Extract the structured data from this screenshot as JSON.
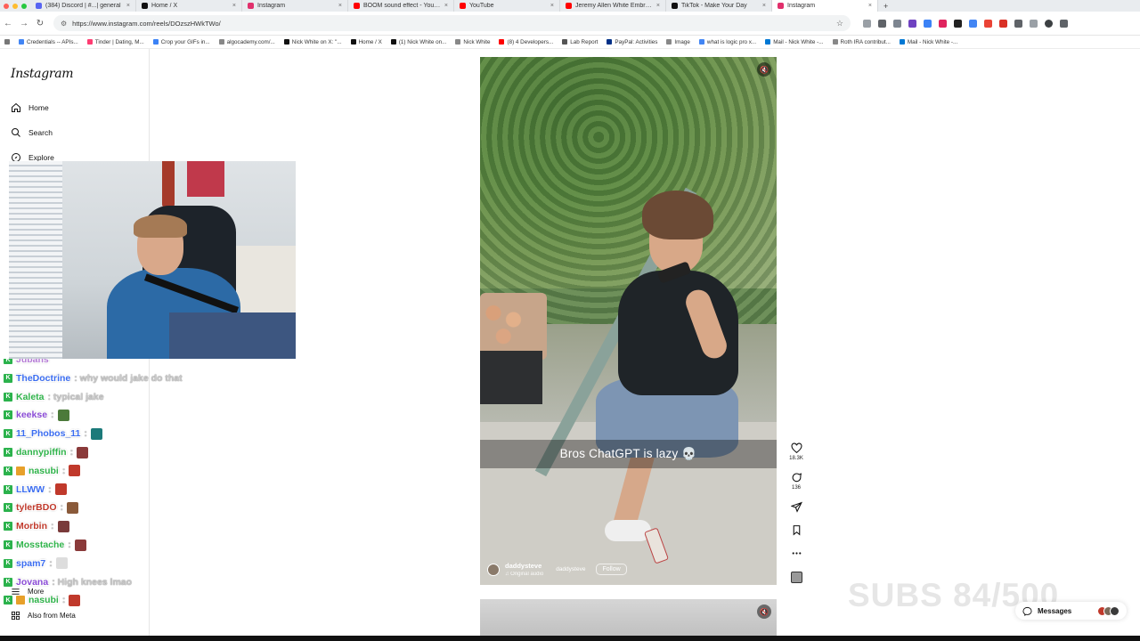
{
  "browser": {
    "tabs": [
      {
        "label": "(384) Discord | #...| general",
        "color": "#5865f2",
        "active": false
      },
      {
        "label": "Home / X",
        "color": "#111111",
        "active": false
      },
      {
        "label": "Instagram",
        "color": "#e1306c",
        "active": false
      },
      {
        "label": "BOOM sound effect - YouTube",
        "color": "#ff0000",
        "active": false
      },
      {
        "label": "YouTube",
        "color": "#ff0000",
        "active": false
      },
      {
        "label": "Jeremy Allen White Embrace",
        "color": "#ff0000",
        "active": false
      },
      {
        "label": "TikTok - Make Your Day",
        "color": "#111111",
        "active": false
      },
      {
        "label": "Instagram",
        "color": "#e1306c",
        "active": true
      }
    ],
    "url": "https://www.instagram.com/reels/DOzszHWkTWo/",
    "bookmarks": [
      {
        "label": "Credentials -- APIs...",
        "color": "#4285f4"
      },
      {
        "label": "Tinder | Dating, M...",
        "color": "#fe3c72"
      },
      {
        "label": "Crop your GIFs in...",
        "color": "#3b82f6"
      },
      {
        "label": "algocademy.com/...",
        "color": "#888888"
      },
      {
        "label": "Nick White on X: \"...",
        "color": "#111111"
      },
      {
        "label": "Home / X",
        "color": "#111111"
      },
      {
        "label": "(1) Nick White on...",
        "color": "#111111"
      },
      {
        "label": "Nick White",
        "color": "#888888"
      },
      {
        "label": "(8) 4 Developers...",
        "color": "#ff0000"
      },
      {
        "label": "Lab Report",
        "color": "#555555"
      },
      {
        "label": "PayPal: Activities",
        "color": "#003087"
      },
      {
        "label": "Image",
        "color": "#888888"
      },
      {
        "label": "what is logic pro x...",
        "color": "#4285f4"
      },
      {
        "label": "Mail - Nick White -...",
        "color": "#0078d4"
      },
      {
        "label": "Roth IRA contribut...",
        "color": "#888888"
      },
      {
        "label": "Mail - Nick White -...",
        "color": "#0078d4"
      }
    ]
  },
  "sidebar": {
    "logo": "Instagram",
    "items": [
      {
        "label": "Home",
        "icon": "home-icon"
      },
      {
        "label": "Search",
        "icon": "search-icon"
      },
      {
        "label": "Explore",
        "icon": "compass-icon"
      }
    ],
    "more": "More",
    "also_from_meta": "Also from Meta"
  },
  "chat": [
    {
      "user": "Jubans",
      "color": "#b57bd6",
      "msg": "",
      "badge": "k"
    },
    {
      "user": "TheDoctrine",
      "color": "#3a6cf0",
      "msg": ": why would jake do that",
      "badge": "k"
    },
    {
      "user": "Kaleta",
      "color": "#2fb34a",
      "msg": ": typical jake",
      "badge": "k"
    },
    {
      "user": "keekse",
      "color": "#8a4bd6",
      "msg": ":",
      "badge": "k",
      "emote": "#4c7a3a"
    },
    {
      "user": "11_Phobos_11",
      "color": "#3a6cf0",
      "msg": ":",
      "badge": "k",
      "emote": "#1c7a7a"
    },
    {
      "user": "dannypiffin",
      "color": "#2fb34a",
      "msg": ":",
      "badge": "k",
      "emote": "#8a3a3a"
    },
    {
      "user": "nasubi",
      "color": "#2fb34a",
      "msg": ":",
      "badge": "k2",
      "emote": "#c0392b"
    },
    {
      "user": "LLWW",
      "color": "#3a6cf0",
      "msg": ":",
      "badge": "k",
      "emote": "#c0392b"
    },
    {
      "user": "tylerBDO",
      "color": "#c0392b",
      "msg": ":",
      "badge": "k",
      "emote": "#8a5a3a"
    },
    {
      "user": "Morbin",
      "color": "#c0392b",
      "msg": ":",
      "badge": "k",
      "emote": "#7a3a3a"
    },
    {
      "user": "Mosstache",
      "color": "#2fb34a",
      "msg": ":",
      "badge": "k",
      "emote": "#8a3a3a"
    },
    {
      "user": "spam7",
      "color": "#3a6cf0",
      "msg": ":",
      "badge": "k",
      "emote": "#dddddd"
    },
    {
      "user": "Jovana",
      "color": "#8a4bd6",
      "msg": ": High knees lmao",
      "badge": "k"
    },
    {
      "user": "nasubi",
      "color": "#2fb34a",
      "msg": ":",
      "badge": "k2",
      "emote": "#c0392b"
    }
  ],
  "reel": {
    "caption": "Bros ChatGPT is lazy 💀",
    "username": "daddysteve",
    "audio": "♫ Original audio",
    "secondary_username": "daddysteve",
    "follow": "Follow"
  },
  "actions": {
    "likes": "18.3K",
    "comments": "136"
  },
  "overlay": {
    "subs": "SUBS 84/500"
  },
  "messages": {
    "label": "Messages"
  }
}
